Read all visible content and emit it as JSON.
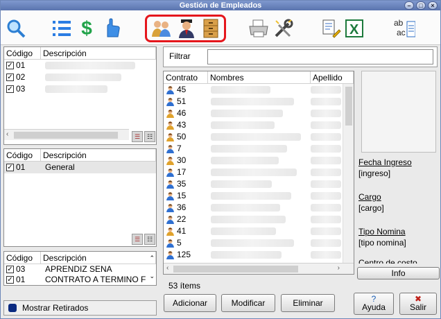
{
  "window": {
    "title": "Gestión de Empleados"
  },
  "toolbar": {
    "icons": [
      "search-icon",
      "list-icon",
      "dollar-icon",
      "hand-pointer-icon",
      "people-icon",
      "graduate-icon",
      "file-cabinet-icon",
      "printer-icon",
      "tools-icon",
      "edit-document-icon",
      "excel-icon",
      "replace-text-icon"
    ],
    "highlight_color": "#e5161c"
  },
  "left_top_grid": {
    "headers": [
      "Código",
      "Descripción"
    ],
    "rows": [
      {
        "code": "01",
        "checked": true
      },
      {
        "code": "02",
        "checked": true
      },
      {
        "code": "03",
        "checked": true
      }
    ]
  },
  "left_mid_grid": {
    "headers": [
      "Código",
      "Descripción"
    ],
    "rows": [
      {
        "code": "01",
        "description": "General",
        "checked": true
      }
    ]
  },
  "left_bottom_grid": {
    "headers": [
      "Código",
      "Descripción"
    ],
    "rows": [
      {
        "code": "03",
        "description": "APRENDIZ SENA",
        "checked": true
      },
      {
        "code": "01",
        "description": "CONTRATO A TERMINO F",
        "checked": true
      }
    ]
  },
  "show_retired": {
    "label": "Mostrar Retirados"
  },
  "filter": {
    "label": "Filtrar",
    "value": ""
  },
  "employees": {
    "headers": [
      "Contrato",
      "Nombres",
      "Apellido"
    ],
    "rows": [
      {
        "contract": "45",
        "gender": "m"
      },
      {
        "contract": "51",
        "gender": "m"
      },
      {
        "contract": "46",
        "gender": "f"
      },
      {
        "contract": "43",
        "gender": "f"
      },
      {
        "contract": "50",
        "gender": "f"
      },
      {
        "contract": "7",
        "gender": "m"
      },
      {
        "contract": "30",
        "gender": "f"
      },
      {
        "contract": "17",
        "gender": "m"
      },
      {
        "contract": "35",
        "gender": "m"
      },
      {
        "contract": "15",
        "gender": "m"
      },
      {
        "contract": "36",
        "gender": "m"
      },
      {
        "contract": "22",
        "gender": "m"
      },
      {
        "contract": "41",
        "gender": "f"
      },
      {
        "contract": "5",
        "gender": "m"
      },
      {
        "contract": "125",
        "gender": "m"
      }
    ],
    "count_text": "53 ítems"
  },
  "details": {
    "hire_date_label": "Fecha Ingreso",
    "hire_date_value": "[ingreso]",
    "position_label": "Cargo",
    "position_value": "[cargo]",
    "payroll_label": "Tipo Nomina",
    "payroll_value": "[tipo nomina]",
    "cost_center_label": "Centro de costo",
    "info_button": "Info"
  },
  "buttons": {
    "add": "Adicionar",
    "modify": "Modificar",
    "delete": "Eliminar",
    "help": "Ayuda",
    "exit": "Salir"
  }
}
